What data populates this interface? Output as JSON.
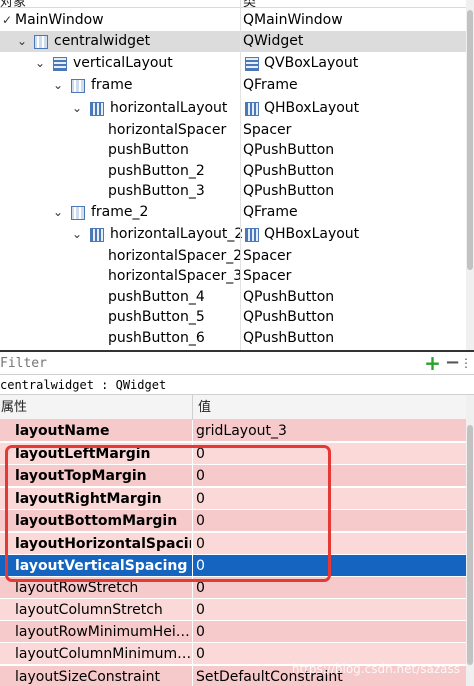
{
  "tree": {
    "header_name": "对象",
    "header_class": "类",
    "rows": [
      {
        "name": "MainWindow",
        "class": "QMainWindow"
      },
      {
        "name": "centralwidget",
        "class": "QWidget"
      },
      {
        "name": "verticalLayout",
        "class": "QVBoxLayout"
      },
      {
        "name": "frame",
        "class": "QFrame"
      },
      {
        "name": "horizontalLayout",
        "class": "QHBoxLayout"
      },
      {
        "name": "horizontalSpacer",
        "class": "Spacer"
      },
      {
        "name": "pushButton",
        "class": "QPushButton"
      },
      {
        "name": "pushButton_2",
        "class": "QPushButton"
      },
      {
        "name": "pushButton_3",
        "class": "QPushButton"
      },
      {
        "name": "frame_2",
        "class": "QFrame"
      },
      {
        "name": "horizontalLayout_2",
        "class": "QHBoxLayout"
      },
      {
        "name": "horizontalSpacer_2",
        "class": "Spacer"
      },
      {
        "name": "horizontalSpacer_3",
        "class": "Spacer"
      },
      {
        "name": "pushButton_4",
        "class": "QPushButton"
      },
      {
        "name": "pushButton_5",
        "class": "QPushButton"
      },
      {
        "name": "pushButton_6",
        "class": "QPushButton"
      }
    ]
  },
  "filter": {
    "placeholder": "Filter",
    "add_label": "+",
    "remove_label": "−",
    "more_label": "⋮"
  },
  "object_label": "centralwidget : QWidget",
  "props": {
    "header_property": "属性",
    "header_value": "值",
    "rows": [
      {
        "name": "layoutName",
        "value": "gridLayout_3"
      },
      {
        "name": "layoutLeftMargin",
        "value": "0"
      },
      {
        "name": "layoutTopMargin",
        "value": "0"
      },
      {
        "name": "layoutRightMargin",
        "value": "0"
      },
      {
        "name": "layoutBottomMargin",
        "value": "0"
      },
      {
        "name": "layoutHorizontalSpacing",
        "value": "0"
      },
      {
        "name": "layoutVerticalSpacing",
        "value": "0"
      },
      {
        "name": "layoutRowStretch",
        "value": "0"
      },
      {
        "name": "layoutColumnStretch",
        "value": "0"
      },
      {
        "name": "layoutRowMinimumHei…",
        "value": "0"
      },
      {
        "name": "layoutColumnMinimum…",
        "value": "0"
      },
      {
        "name": "layoutSizeConstraint",
        "value": "SetDefaultConstraint"
      }
    ]
  },
  "watermark": "https://blog.csdn.net/sazass",
  "colors": {
    "pink_dark": "#f6c9ca",
    "pink_light": "#fbd9d9",
    "selection": "#1565c0",
    "highlight_box": "#e53935"
  }
}
